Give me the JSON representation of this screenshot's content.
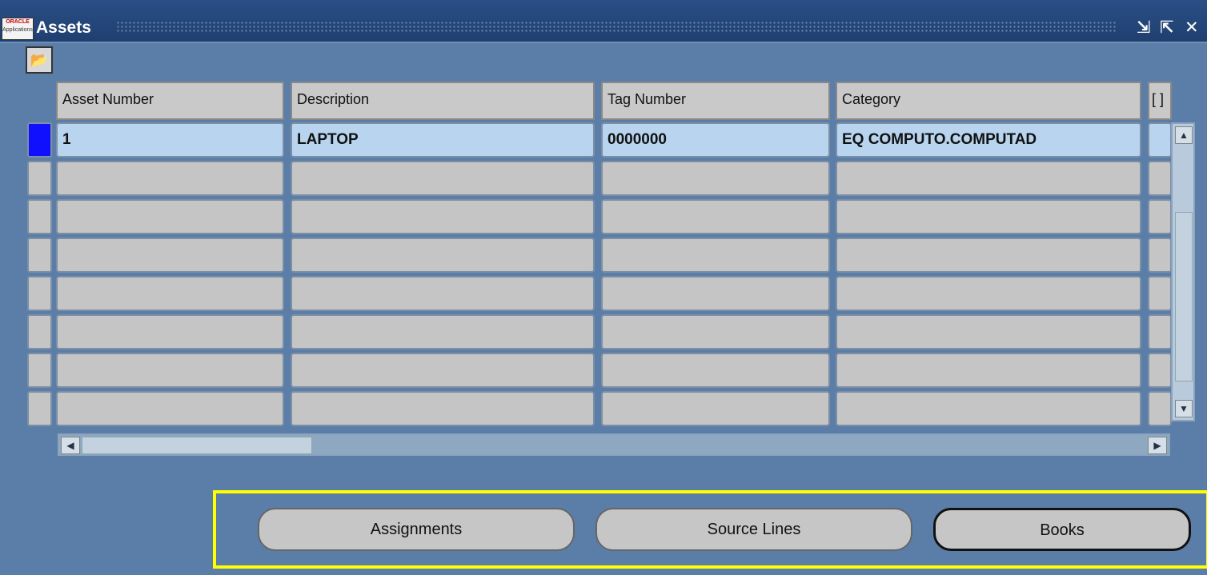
{
  "window": {
    "logo_text": "ORACLE Applications",
    "title": "Assets",
    "controls": [
      "minimize-icon",
      "maximize-icon",
      "close-icon"
    ]
  },
  "toolbar": {
    "open_folder_icon": "folder-open-icon"
  },
  "table": {
    "columns": [
      "Asset Number",
      "Description",
      "Tag Number",
      "Category",
      "[ ]"
    ],
    "rows": [
      {
        "asset_number": "1",
        "description": "LAPTOP",
        "tag_number": "0000000",
        "category": "EQ COMPUTO.COMPUTAD",
        "extra": ""
      },
      {
        "asset_number": "",
        "description": "",
        "tag_number": "",
        "category": "",
        "extra": ""
      },
      {
        "asset_number": "",
        "description": "",
        "tag_number": "",
        "category": "",
        "extra": ""
      },
      {
        "asset_number": "",
        "description": "",
        "tag_number": "",
        "category": "",
        "extra": ""
      },
      {
        "asset_number": "",
        "description": "",
        "tag_number": "",
        "category": "",
        "extra": ""
      },
      {
        "asset_number": "",
        "description": "",
        "tag_number": "",
        "category": "",
        "extra": ""
      },
      {
        "asset_number": "",
        "description": "",
        "tag_number": "",
        "category": "",
        "extra": ""
      },
      {
        "asset_number": "",
        "description": "",
        "tag_number": "",
        "category": "",
        "extra": ""
      }
    ],
    "selected_row": 0
  },
  "buttons": {
    "assignments": "Assignments",
    "source_lines": "Source Lines",
    "books": "Books"
  },
  "colors": {
    "highlight": "#ffff00",
    "current_row": "#b8d4ef",
    "row_marker": "#1010ff"
  }
}
